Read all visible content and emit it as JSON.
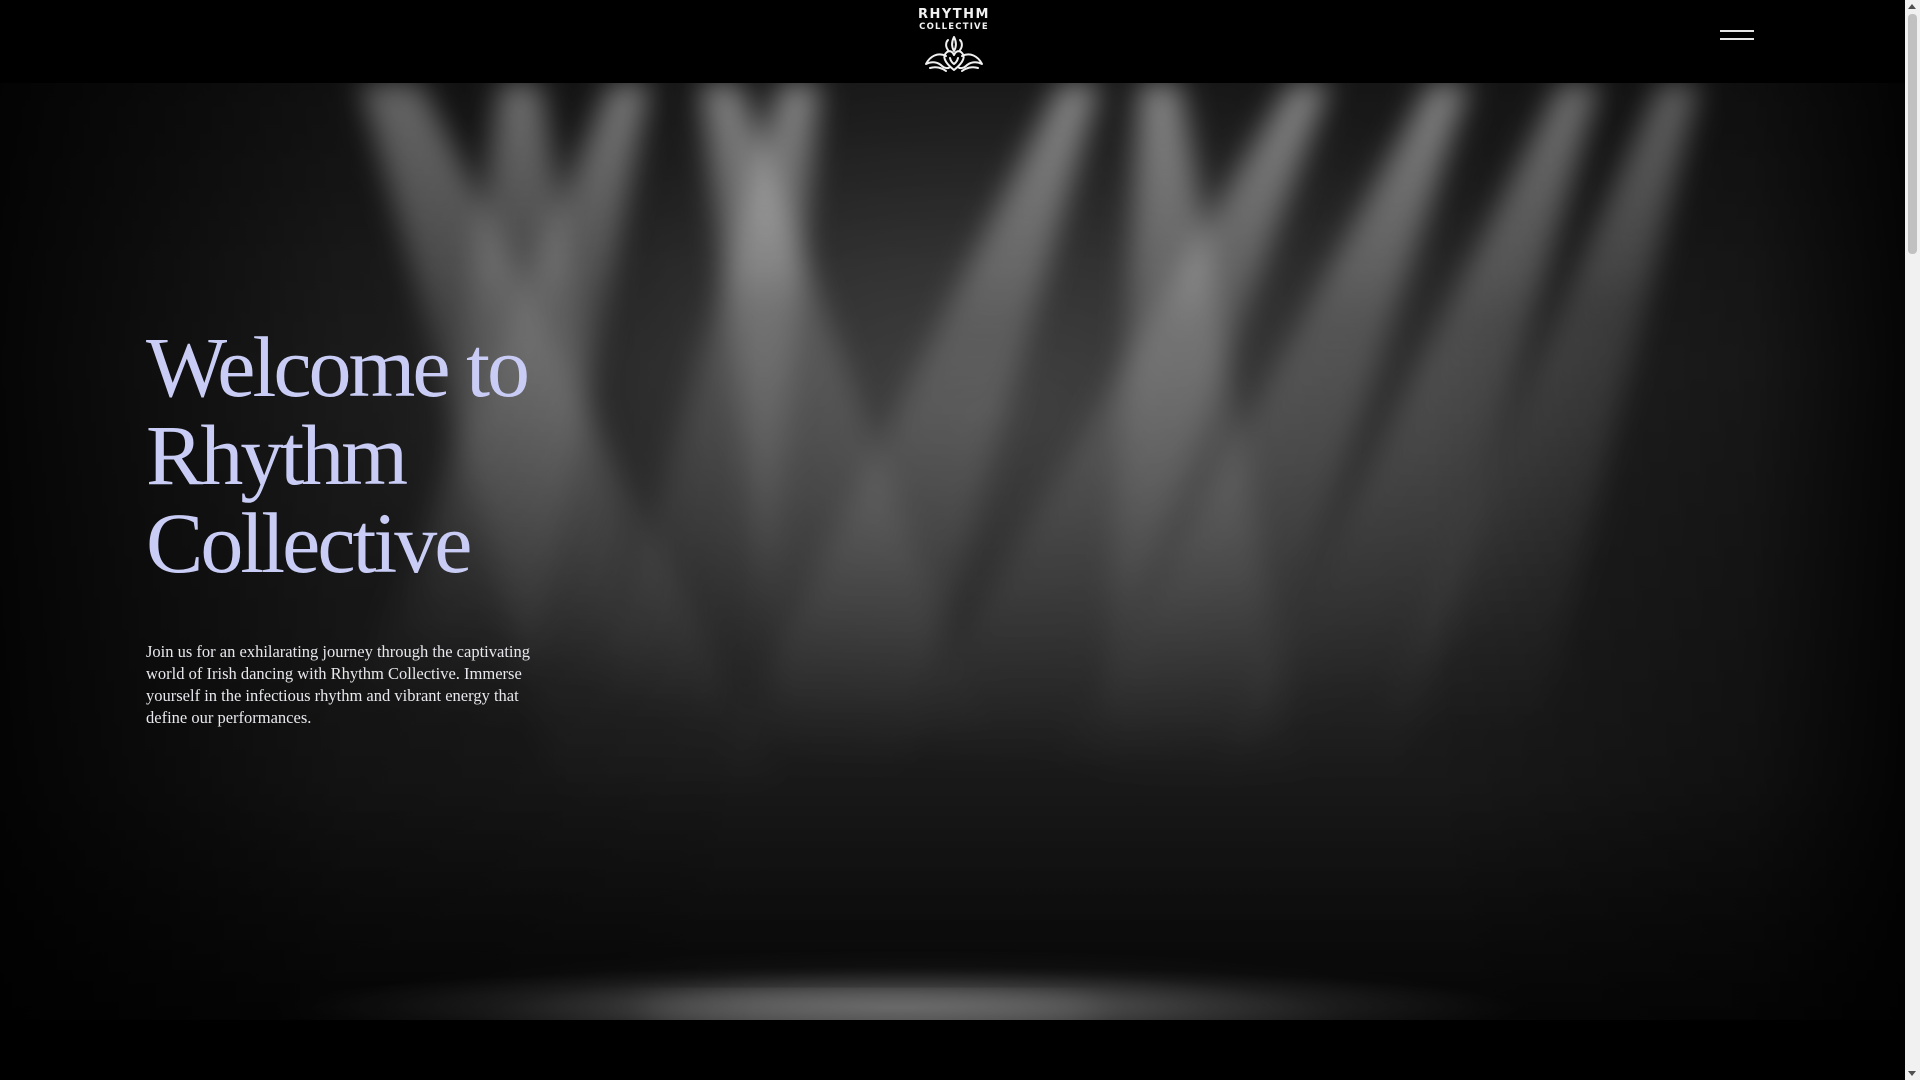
{
  "header": {
    "logo": {
      "line1": "RHYTHM",
      "line2": "COLLECTIVE",
      "icon": "celtic-heart-knot-icon"
    },
    "menu_icon": "hamburger-menu-icon"
  },
  "hero": {
    "title_lines": [
      "Welcome to",
      "Rhythm",
      "Collective"
    ],
    "description": "Join us for an exhilarating journey through the captivating world of Irish dancing with Rhythm Collective. Immerse yourself in the infectious rhythm and vibrant energy that define our performances.",
    "background": "stage-spotlights-image"
  },
  "colors": {
    "title": "#c9cdf5",
    "body_text": "#e8e8ee",
    "header_bg": "#000000"
  }
}
